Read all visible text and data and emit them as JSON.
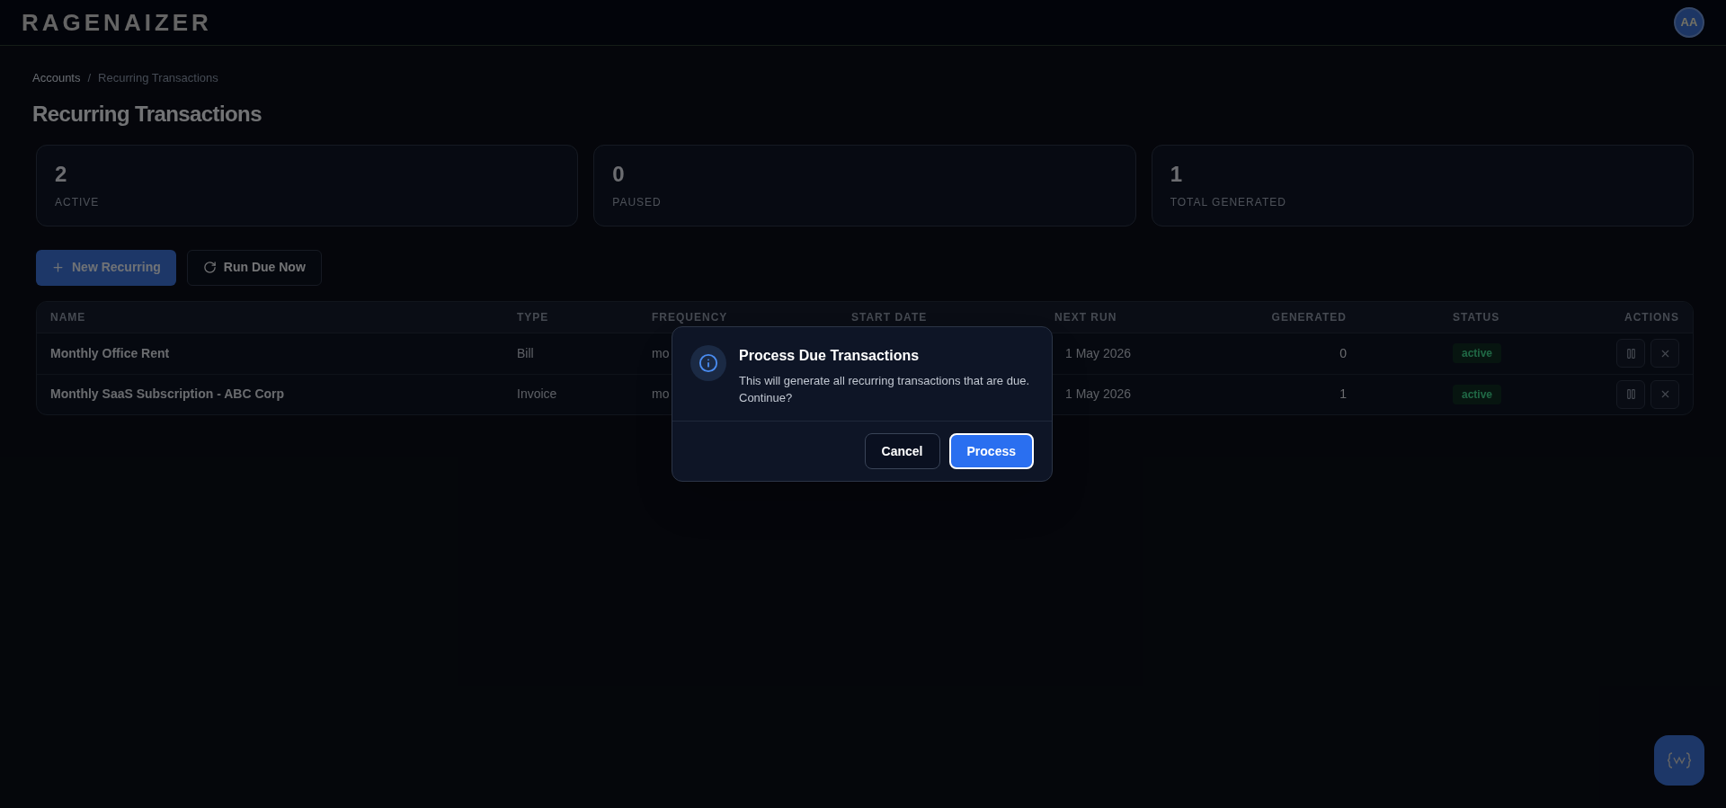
{
  "brand": "RAGENAIZER",
  "user": {
    "initials": "AA"
  },
  "breadcrumb": [
    "Accounts",
    "Recurring Transactions"
  ],
  "breadcrumb_separator": "/",
  "title": "Recurring Transactions",
  "stats": [
    {
      "value": "2",
      "label": "ACTIVE"
    },
    {
      "value": "0",
      "label": "PAUSED"
    },
    {
      "value": "1",
      "label": "TOTAL GENERATED"
    }
  ],
  "actions": [
    {
      "kind": "primary",
      "label": "New Recurring"
    },
    {
      "kind": "secondary",
      "label": "Run Due Now"
    }
  ],
  "table": {
    "columns": [
      "NAME",
      "TYPE",
      "FREQUENCY",
      "START DATE",
      "NEXT RUN",
      "GENERATED",
      "STATUS",
      "ACTIONS"
    ],
    "rows": [
      {
        "name": "Monthly Office Rent",
        "type": "Bill",
        "frequency": "mo",
        "next_run": "1 May 2026",
        "generated": "0",
        "status": "active"
      },
      {
        "name": "Monthly SaaS Subscription - ABC Corp",
        "type": "Invoice",
        "frequency": "mo",
        "next_run": "1 May 2026",
        "generated": "1",
        "status": "active"
      }
    ]
  },
  "dialog": {
    "title": "Process Due Transactions",
    "message": "This will generate all recurring transactions that are due. Continue?",
    "buttons": [
      {
        "kind": "cancel",
        "label": "Cancel"
      },
      {
        "kind": "confirm",
        "label": "Process"
      }
    ]
  }
}
